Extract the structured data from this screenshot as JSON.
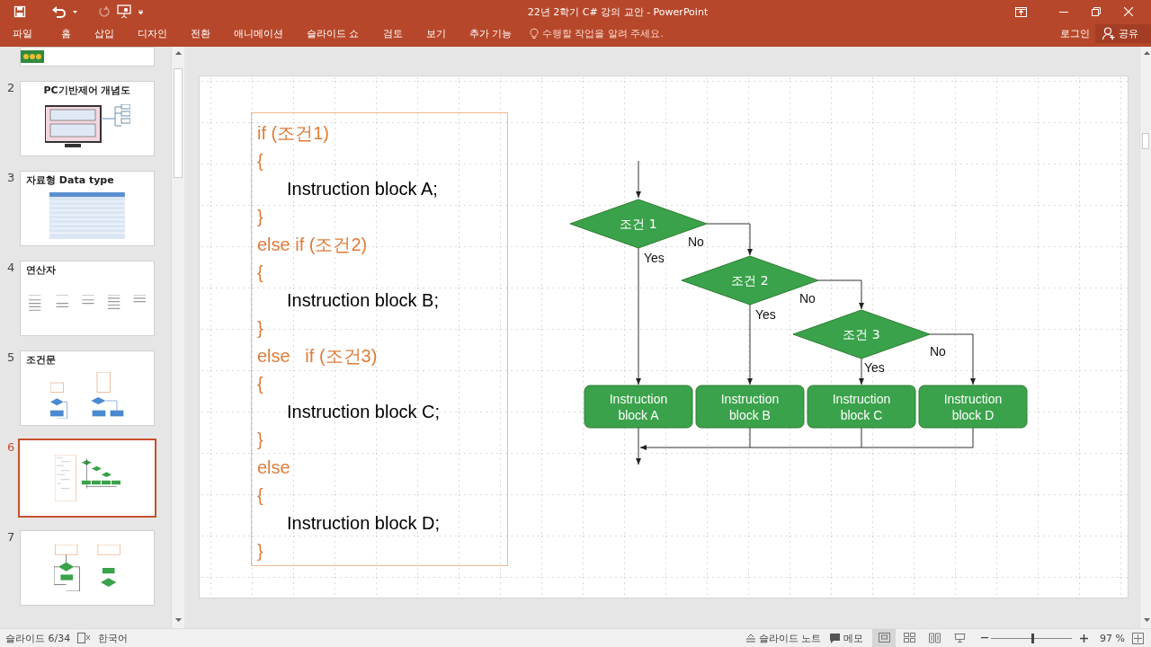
{
  "window": {
    "title": "22년 2학기 C# 강의 교안 - PowerPoint",
    "redo_disabled": true
  },
  "ribbon": {
    "tabs": [
      {
        "label": "파일"
      },
      {
        "label": "홈"
      },
      {
        "label": "삽입"
      },
      {
        "label": "디자인"
      },
      {
        "label": "전환"
      },
      {
        "label": "애니메이션"
      },
      {
        "label": "슬라이드 쇼"
      },
      {
        "label": "검토"
      },
      {
        "label": "보기"
      },
      {
        "label": "추가 기능"
      }
    ],
    "tell_me": "수행할 작업을 알려 주세요.",
    "login": "로그인",
    "share": "공유"
  },
  "thumbnails": [
    {
      "kind": "partial",
      "selected": false
    },
    {
      "number": "2",
      "title": "PC기반제어 개념도",
      "kind": "monitor",
      "selected": false
    },
    {
      "number": "3",
      "title": "자료형 Data type",
      "kind": "table",
      "selected": false
    },
    {
      "number": "4",
      "title": "연산자",
      "kind": "columns",
      "selected": false
    },
    {
      "number": "5",
      "title": "조건문",
      "kind": "blue-flow",
      "selected": false
    },
    {
      "number": "6",
      "kind": "green-flow",
      "selected": true
    },
    {
      "number": "7",
      "kind": "loop-flow",
      "selected": false
    }
  ],
  "slide": {
    "code": [
      {
        "kind": "keyword",
        "text": "if (조건1)"
      },
      {
        "kind": "keyword",
        "text": "{"
      },
      {
        "kind": "body",
        "text": "Instruction block A;"
      },
      {
        "kind": "keyword",
        "text": "}"
      },
      {
        "kind": "keyword",
        "text": "else if (조건2)"
      },
      {
        "kind": "keyword",
        "text": "{"
      },
      {
        "kind": "body",
        "text": "Instruction block B;"
      },
      {
        "kind": "keyword",
        "text": "}"
      },
      {
        "kind": "keyword",
        "text": "else   if (조건3)"
      },
      {
        "kind": "keyword",
        "text": "{"
      },
      {
        "kind": "body",
        "text": "Instruction block C;"
      },
      {
        "kind": "keyword",
        "text": "}"
      },
      {
        "kind": "keyword",
        "text": "else"
      },
      {
        "kind": "keyword",
        "text": "{"
      },
      {
        "kind": "body",
        "text": "Instruction block D;"
      },
      {
        "kind": "keyword",
        "text": "}"
      }
    ],
    "flowchart": {
      "decisions": [
        {
          "label": "조건 1",
          "yes": "Yes",
          "no": "No"
        },
        {
          "label": "조건 2",
          "yes": "Yes",
          "no": "No"
        },
        {
          "label": "조건 3",
          "yes": "Yes",
          "no": "No"
        }
      ],
      "blocks": [
        {
          "lines": [
            "Instruction",
            "block A"
          ]
        },
        {
          "lines": [
            "Instruction",
            "block B"
          ]
        },
        {
          "lines": [
            "Instruction",
            "block C"
          ]
        },
        {
          "lines": [
            "Instruction",
            "block D"
          ]
        }
      ]
    }
  },
  "status_bar": {
    "slide_counter": "슬라이드 6/34",
    "language": "한국어",
    "notes": "슬라이드 노트",
    "comments": "메모",
    "views": [
      {
        "kind": "normal",
        "selected": true
      },
      {
        "kind": "sorter",
        "selected": false
      },
      {
        "kind": "reading",
        "selected": false
      },
      {
        "kind": "show",
        "selected": false
      }
    ],
    "zoom": {
      "level": 0.51,
      "reading": "97 %"
    }
  }
}
